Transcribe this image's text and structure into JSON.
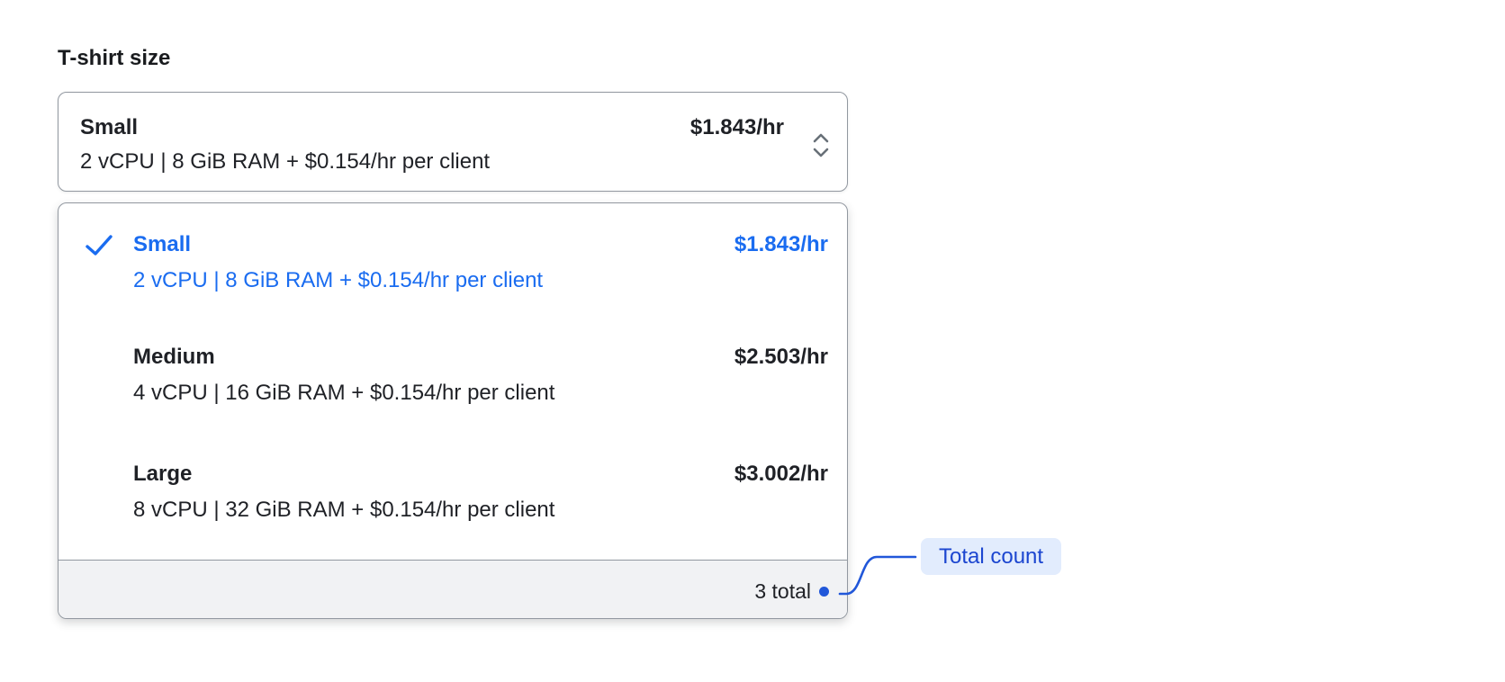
{
  "field": {
    "label": "T-shirt size"
  },
  "select": {
    "selected": {
      "name": "Small",
      "description": "2 vCPU | 8 GiB RAM + $0.154/hr per client",
      "price": "$1.843/hr"
    },
    "chevron_icon": "chevron-up-down"
  },
  "dropdown": {
    "options": [
      {
        "name": "Small",
        "description": "2 vCPU | 8 GiB RAM + $0.154/hr per client",
        "price": "$1.843/hr",
        "selected": true,
        "check_icon": "checkmark"
      },
      {
        "name": "Medium",
        "description": "4 vCPU | 16 GiB RAM + $0.154/hr per client",
        "price": "$2.503/hr",
        "selected": false
      },
      {
        "name": "Large",
        "description": "8 vCPU | 32 GiB RAM + $0.154/hr per client",
        "price": "$3.002/hr",
        "selected": false
      }
    ],
    "footer": {
      "total_label": "3 total"
    }
  },
  "annotation": {
    "label": "Total count"
  },
  "colors": {
    "text": "#1f2126",
    "border": "#9298a0",
    "selected_option_blue": "#1a6cf0",
    "annotation_line": "#2157d9",
    "annotation_text": "#1c46d0",
    "annotation_badge_bg": "#e2ecfd",
    "footer_bg": "#f1f2f4",
    "chevron_gray": "#687078"
  }
}
